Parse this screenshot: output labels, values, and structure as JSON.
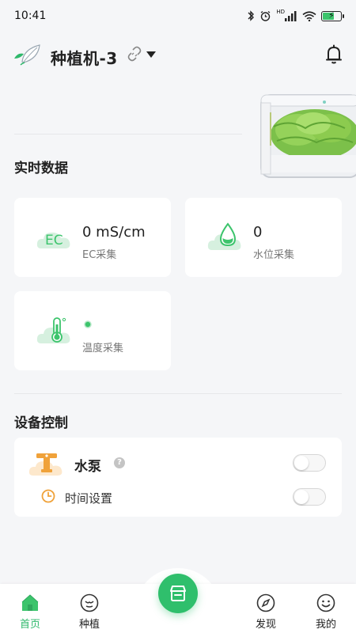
{
  "status_bar": {
    "time": "10:41",
    "network": "HD"
  },
  "header": {
    "device_name": "种植机-3"
  },
  "realtime": {
    "title": "实时数据",
    "ec": {
      "icon_text": "EC",
      "value": "0 mS/cm",
      "label": "EC采集"
    },
    "water": {
      "value": "0",
      "label": "水位采集"
    },
    "temperature": {
      "value": "",
      "label": "温度采集"
    }
  },
  "control": {
    "title": "设备控制",
    "pump": {
      "label": "水泵",
      "help": "?",
      "enabled": false
    },
    "timer": {
      "label": "时间设置",
      "enabled": false
    }
  },
  "tabbar": {
    "home": "首页",
    "plant": "种植",
    "discover": "发现",
    "mine": "我的"
  },
  "colors": {
    "accent": "#2fb86b",
    "pump_icon": "#f0a23a",
    "timer_icon": "#f0a23a"
  }
}
